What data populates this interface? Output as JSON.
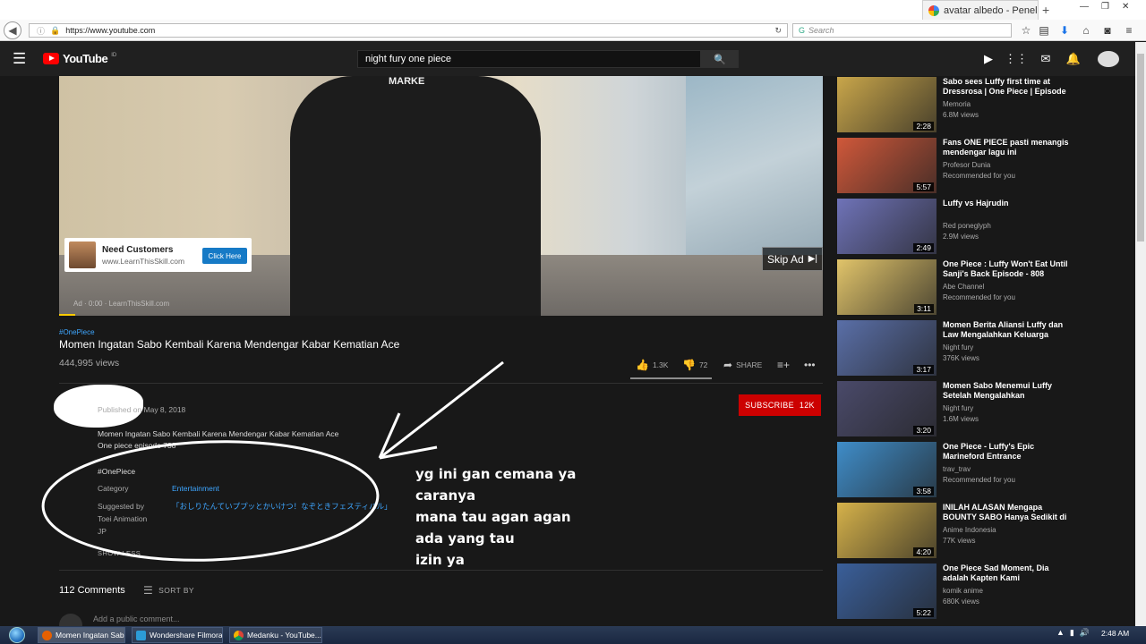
{
  "browser": {
    "tab_title": "avatar albedo - Penel",
    "new_tab": "+",
    "url": "https://www.youtube.com",
    "search_placeholder": "Search",
    "window_controls": [
      "—",
      "❐",
      "✕"
    ]
  },
  "youtube": {
    "logo_text": "YouTube",
    "logo_region": "ID",
    "search_query": "night fury one piece"
  },
  "ad": {
    "shirt_text": "MARKE",
    "card_title": "Need Customers",
    "card_url": "www.LearnThisSkill.com",
    "card_button": "Click Here",
    "skip_label": "Skip Ad",
    "ad_label": "Ad · 0:00 · LearnThisSkill.com"
  },
  "video": {
    "hashtag": "#OnePiece",
    "title": "Momen Ingatan Sabo Kembali Karena Mendengar Kabar Kematian Ace",
    "views": "444,995 views",
    "likes": "1.3K",
    "dislikes": "72",
    "share": "SHARE",
    "published": "Published on May 8, 2018",
    "subscribe": "SUBSCRIBE",
    "subscribers": "12K",
    "description_line1": "Momen Ingatan Sabo Kembali Karena Mendengar Kabar Kematian Ace",
    "description_line2": "One piece episode 738",
    "description_tag": "#OnePiece",
    "category_label": "Category",
    "category_value": "Entertainment",
    "suggested_label_1": "Suggested by",
    "suggested_label_2": "Toei Animation",
    "suggested_label_3": "JP",
    "suggested_value": "「おしりたんていププッとかいけつ！なぞときフェスティバル」",
    "show_less": "SHOW LESS"
  },
  "comments": {
    "count": "112 Comments",
    "sort": "SORT BY",
    "add_placeholder": "Add a public comment..."
  },
  "annotation": {
    "lines": [
      "yg ini gan cemana ya",
      "caranya",
      "mana tau agan agan",
      "ada yang tau",
      "izin ya"
    ]
  },
  "recommendations": [
    {
      "title": "Sabo sees Luffy first time at Dressrosa | One Piece | Episode",
      "channel": "Memoria",
      "meta": "6.8M views",
      "duration": "2:28",
      "color": "#c9a64a"
    },
    {
      "title": "Fans ONE PIECE pasti menangis mendengar lagu ini",
      "channel": "Profesor Dunia",
      "meta": "Recommended for you",
      "duration": "5:57",
      "color": "#d0583a"
    },
    {
      "title": "Luffy vs Hajrudin",
      "channel": "Red poneglyph",
      "meta": "2.9M views",
      "duration": "2:49",
      "color": "#6f73b8"
    },
    {
      "title": "One Piece : Luffy Won't Eat Until Sanji's Back Episode - 808",
      "channel": "Abe Channel",
      "meta": "Recommended for you",
      "duration": "3:11",
      "color": "#e1c46a"
    },
    {
      "title": "Momen Berita Aliansi Luffy dan Law Mengalahkan Keluarga",
      "channel": "Night fury",
      "meta": "376K views",
      "duration": "3:17",
      "color": "#5a6fa8"
    },
    {
      "title": "Momen Sabo Menemui Luffy Setelah Mengalahkan",
      "channel": "Night fury",
      "meta": "1.6M views",
      "duration": "3:20",
      "color": "#4a4a6a"
    },
    {
      "title": "One Piece - Luffy's Epic Marineford Entrance",
      "channel": "trav_trav",
      "meta": "Recommended for you",
      "duration": "3:58",
      "color": "#3f8dc9"
    },
    {
      "title": "INILAH ALASAN Mengapa BOUNTY SABO Hanya Sedikit di",
      "channel": "Anime Indonesia",
      "meta": "77K views",
      "duration": "4:20",
      "color": "#d6b24a"
    },
    {
      "title": "One Piece Sad Moment, Dia adalah Kapten Kami",
      "channel": "komik anime",
      "meta": "680K views",
      "duration": "5:22",
      "color": "#3a5f9a"
    }
  ],
  "taskbar": {
    "tasks": [
      "Momen Ingatan Sab...",
      "Wondershare Filmora",
      "Medanku - YouTube..."
    ],
    "clock": "2:48 AM"
  }
}
